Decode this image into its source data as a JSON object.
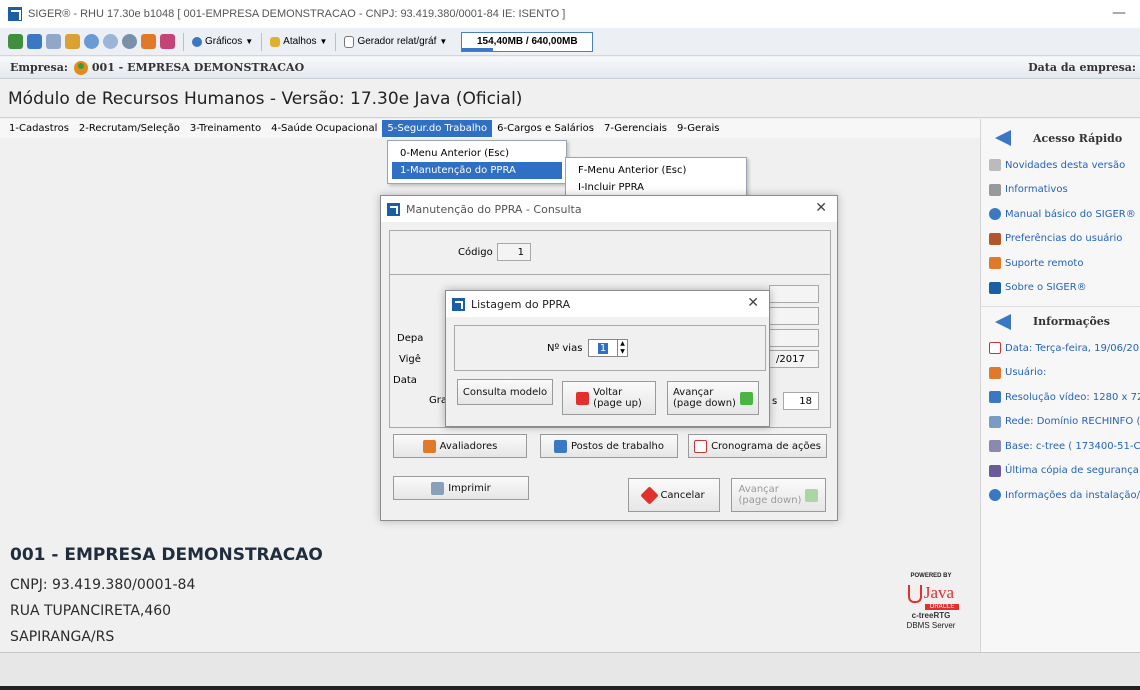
{
  "window": {
    "title": "SIGER® - RHU 17.30e b1048 [ 001-EMPRESA DEMONSTRACAO - CNPJ: 93.419.380/0001-84 IE: ISENTO ]",
    "minimize": "—"
  },
  "toolbar": {
    "graficos": "Gráficos",
    "atalhos": "Atalhos",
    "gerador": "Gerador relat/gráf",
    "memory": "154,40MB / 640,00MB",
    "memory_used_fraction": 0.24
  },
  "empresa_bar": {
    "label": "Empresa:",
    "value": "001 - EMPRESA DEMONSTRACAO",
    "right": "Data da empresa:"
  },
  "module_title": "Módulo de Recursos Humanos - Versão: 17.30e Java (Oficial)",
  "menu": [
    "1-Cadastros",
    "2-Recrutam/Seleção",
    "3-Treinamento",
    "4-Saúde Ocupacional",
    "5-Segur.do Trabalho",
    "6-Cargos e Salários",
    "7-Gerenciais",
    "9-Gerais"
  ],
  "submenu1": [
    "0-Menu Anterior (Esc)",
    "1-Manutenção do PPRA"
  ],
  "submenu2": [
    "F-Menu Anterior (Esc)",
    "I-Incluir PPRA"
  ],
  "right_panel": {
    "acesso_title": "Acesso Rápido",
    "acesso_items": [
      "Novidades desta versão",
      "Informativos",
      "Manual básico do SIGER®",
      "Preferências do usuário",
      "Suporte remoto",
      "Sobre o SIGER®"
    ],
    "info_title": "Informações",
    "info_items": [
      "Data: Terça-feira, 19/06/20",
      "Usuário:",
      "Resolução vídeo: 1280 x 720",
      "Rede: Domínio RECHINFO ( 1",
      "Base: c-tree ( 173400-51-CM",
      "Última cópia de segurança: N",
      "Informações da instalação/at"
    ]
  },
  "company": {
    "name": "001 - EMPRESA DEMONSTRACAO",
    "cnpj": "CNPJ: 93.419.380/0001-84",
    "address": "RUA TUPANCIRETA,460",
    "city": "SAPIRANGA/RS"
  },
  "powered": {
    "powered_by": "POWERED BY",
    "java": "Java",
    "oracle": "ORACLE",
    "ctree": "c-treeRTG",
    "dbms": "DBMS Server"
  },
  "dialog_main": {
    "title": "Manutenção do PPRA - Consulta",
    "close": "✕",
    "codigo_label": "Código",
    "codigo_value": "1",
    "depa_label": "Depa",
    "vige_label": "Vigê",
    "data_label": "Data",
    "gra_label": "Gra",
    "s_label": "s",
    "date_partial": "/2017",
    "num_value": "18",
    "avaliadores": "Avaliadores",
    "postos": "Postos de trabalho",
    "cronograma": "Cronograma de ações",
    "imprimir": "Imprimir",
    "cancelar": "Cancelar",
    "avancar_l1": "Avançar",
    "avancar_l2": "(page down)"
  },
  "dialog_list": {
    "title": "Listagem do PPRA",
    "close": "✕",
    "vias_label": "Nº vias",
    "vias_value": "1",
    "consulta": "Consulta modelo",
    "voltar_l1": "Voltar",
    "voltar_l2": "(page up)",
    "avancar_l1": "Avançar",
    "avancar_l2": "(page down)"
  }
}
